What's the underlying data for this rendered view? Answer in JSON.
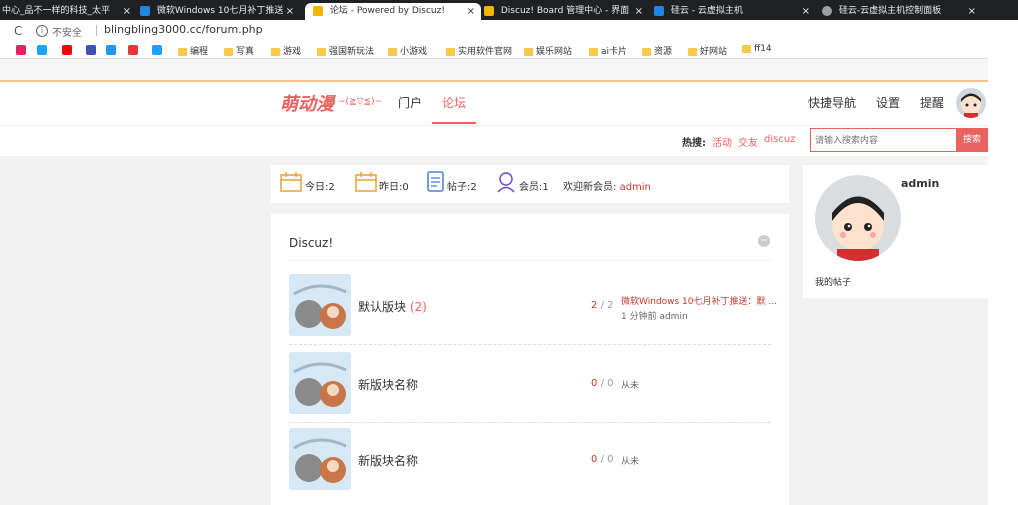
{
  "browser": {
    "tabs": [
      {
        "title": "中心_品不一样的科技_太平",
        "close": "×"
      },
      {
        "title": "微软Windows 10七月补丁推送",
        "close": "×"
      },
      {
        "title": "论坛 - Powered by Discuz!",
        "close": "×"
      },
      {
        "title": "Discuz! Board 管理中心 - 界面",
        "close": "×"
      },
      {
        "title": "硅云 - 云虚拟主机",
        "close": "×"
      },
      {
        "title": "硅云-云虚拟主机控制面板",
        "close": "×"
      }
    ],
    "reload_glyph": "C",
    "security_label": "不安全",
    "url": "blingbling3000.cc/forum.php",
    "bookmarks": [
      "编程",
      "写真",
      "游戏",
      "强国新玩法",
      "小游戏",
      "实用软件官网",
      "娱乐网站",
      "ai卡片",
      "资源",
      "好网站",
      "ff14"
    ],
    "bookmark_icon_colors": [
      "#e91e63",
      "#1da1f2",
      "#ff0000",
      "#3f51b5",
      "#2196f3",
      "#e53935",
      "#1da1f2"
    ]
  },
  "site": {
    "logo": "萌动漫",
    "logo_sub": "~(≧▽≦)~",
    "nav": [
      "门户",
      "论坛"
    ],
    "right_nav": [
      "快捷导航",
      "设置",
      "提醒"
    ],
    "hot_label": "热搜:",
    "hot_links": [
      "活动",
      "交友",
      "discuz"
    ],
    "search_placeholder": "请输入搜索内容",
    "search_button": "搜索",
    "accent": "#e8625f",
    "brand": "#f1c38a"
  },
  "stats": {
    "today_label": "今日:",
    "today": "2",
    "yesterday_label": "昨日:",
    "yesterday": "0",
    "posts_label": "帖子:",
    "posts": "2",
    "members_label": "会员:",
    "members": "1",
    "welcome_label": "欢迎新会员:",
    "new_member": "admin"
  },
  "forum": {
    "group_title": "Discuz!",
    "rows": [
      {
        "name": "默认版块",
        "today": "(2)",
        "threads": "2",
        "sep": "/",
        "posts": "2",
        "last_title": "微软Windows 10七月补丁推送：默 ...",
        "last_meta": "1 分钟前 admin"
      },
      {
        "name": "新版块名称",
        "today": "",
        "threads": "0",
        "sep": "/",
        "posts": "0",
        "last_title": "从未",
        "last_meta": ""
      },
      {
        "name": "新版块名称",
        "today": "",
        "threads": "0",
        "sep": "/",
        "posts": "0",
        "last_title": "从未",
        "last_meta": ""
      }
    ]
  },
  "profile": {
    "username": "admin",
    "my_posts": "我的帖子"
  }
}
